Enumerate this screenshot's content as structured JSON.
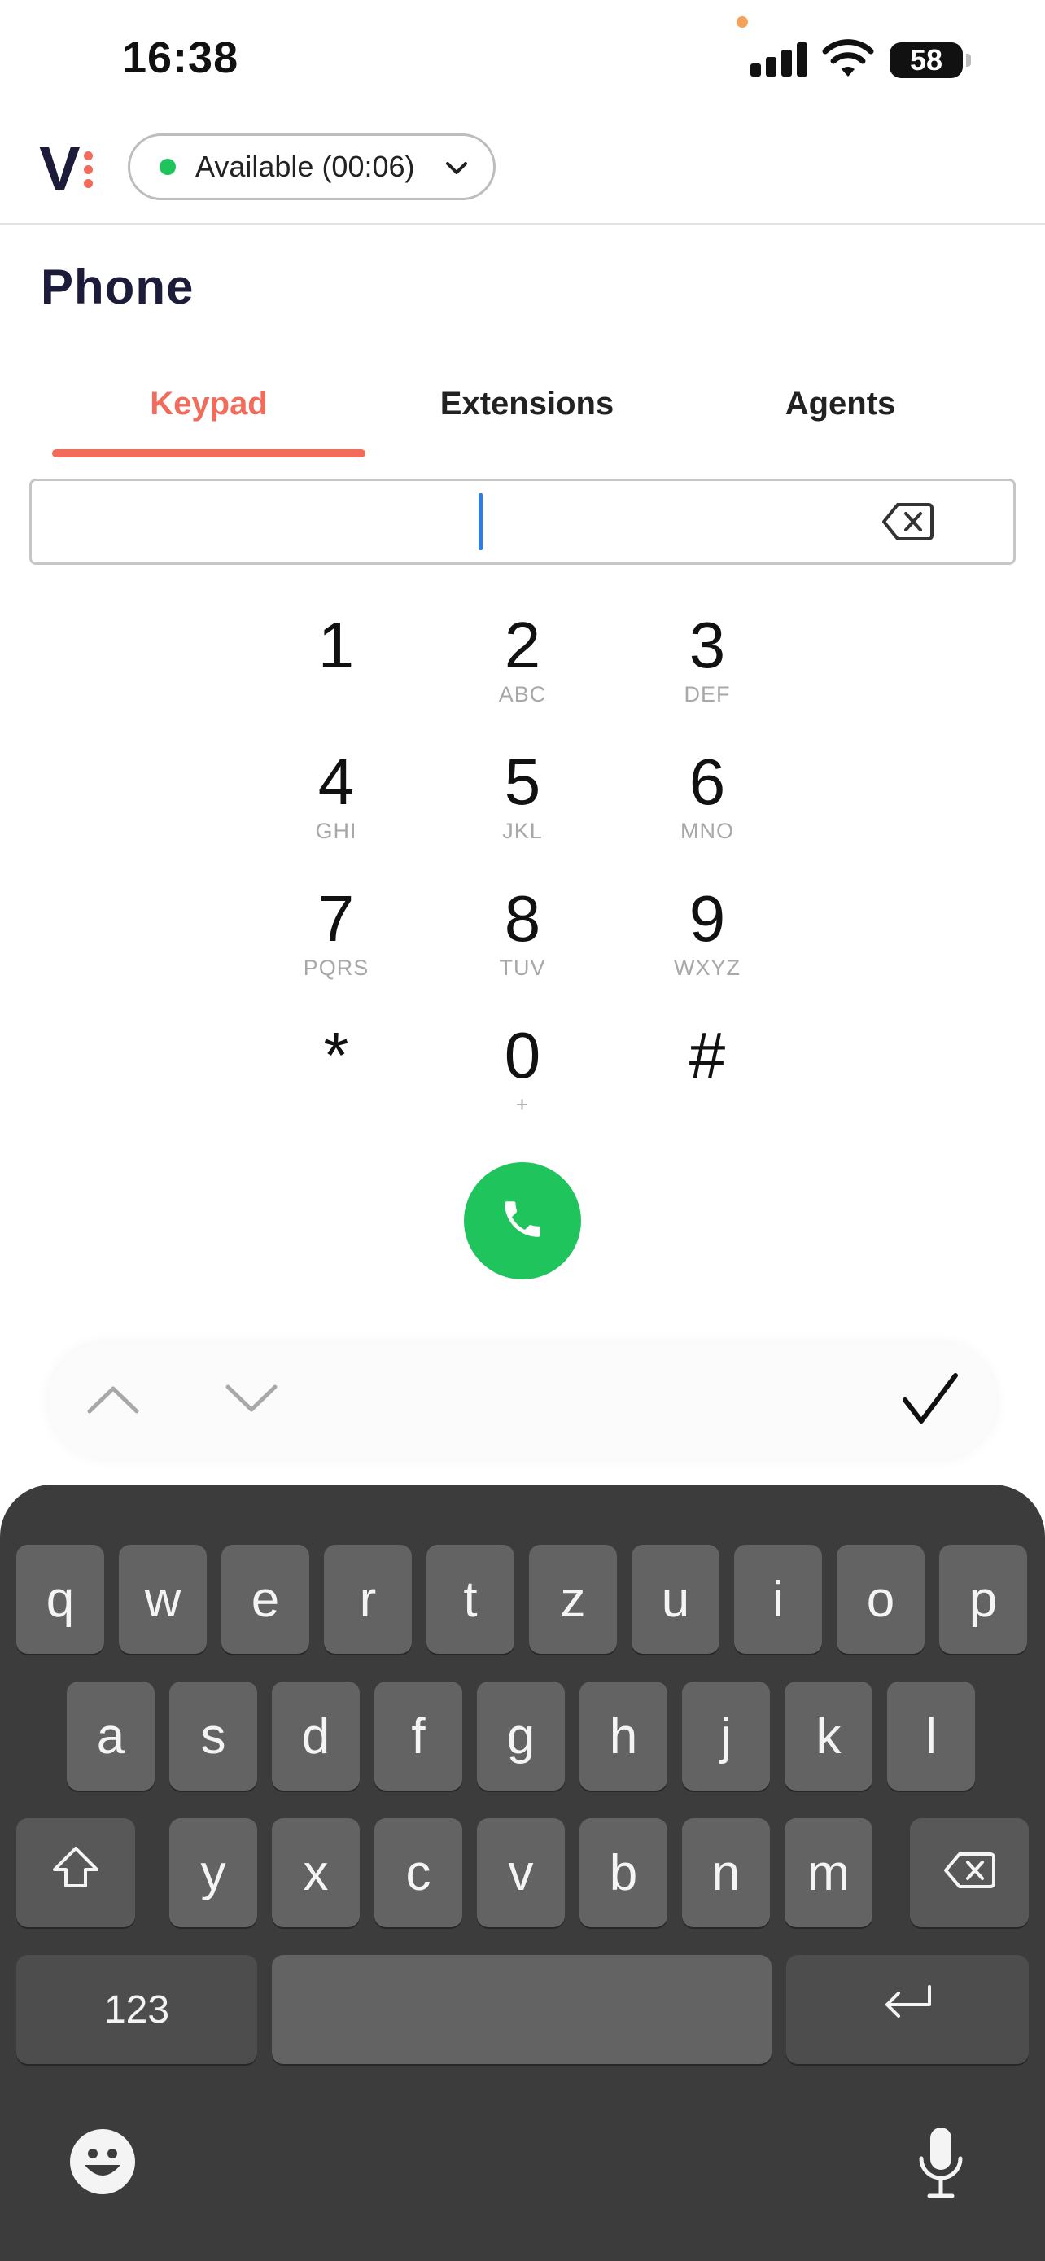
{
  "status_bar": {
    "time": "16:38",
    "battery": "58"
  },
  "header": {
    "presence_label": "Available (00:06)"
  },
  "page": {
    "title": "Phone"
  },
  "tabs": [
    {
      "label": "Keypad",
      "active": true
    },
    {
      "label": "Extensions",
      "active": false
    },
    {
      "label": "Agents",
      "active": false
    }
  ],
  "dial_input": {
    "value": ""
  },
  "keypad": [
    {
      "digit": "1",
      "letters": ""
    },
    {
      "digit": "2",
      "letters": "ABC"
    },
    {
      "digit": "3",
      "letters": "DEF"
    },
    {
      "digit": "4",
      "letters": "GHI"
    },
    {
      "digit": "5",
      "letters": "JKL"
    },
    {
      "digit": "6",
      "letters": "MNO"
    },
    {
      "digit": "7",
      "letters": "PQRS"
    },
    {
      "digit": "8",
      "letters": "TUV"
    },
    {
      "digit": "9",
      "letters": "WXYZ"
    },
    {
      "digit": "*",
      "letters": ""
    },
    {
      "digit": "0",
      "letters": "+"
    },
    {
      "digit": "#",
      "letters": ""
    }
  ],
  "keyboard": {
    "row1": [
      "q",
      "w",
      "e",
      "r",
      "t",
      "z",
      "u",
      "i",
      "o",
      "p"
    ],
    "row2": [
      "a",
      "s",
      "d",
      "f",
      "g",
      "h",
      "j",
      "k",
      "l"
    ],
    "row3": [
      "y",
      "x",
      "c",
      "v",
      "b",
      "n",
      "m"
    ],
    "numbers_label": "123"
  },
  "colors": {
    "accent": "#f26b5b",
    "call_green": "#1fc45c",
    "brand_navy": "#1c1c3a",
    "caret_blue": "#2b7de9"
  },
  "icons": [
    "orange-privacy-dot",
    "signal-icon",
    "wifi-icon",
    "battery-icon",
    "logo",
    "chevron-down-icon",
    "backspace-icon",
    "phone-icon",
    "chevron-up-icon",
    "chevron-down-icon",
    "checkmark-icon",
    "shift-icon",
    "delete-icon",
    "return-icon",
    "emoji-icon",
    "microphone-icon"
  ]
}
